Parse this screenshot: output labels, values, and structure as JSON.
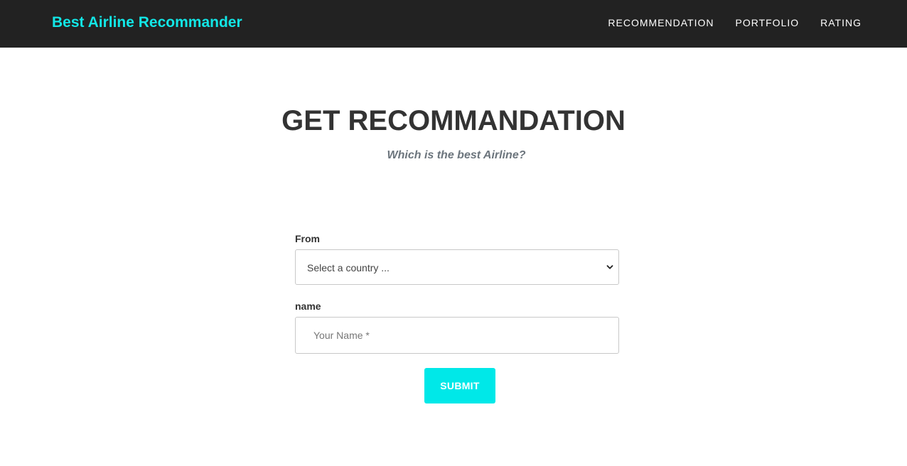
{
  "navbar": {
    "brand": "Best Airline Recommander",
    "links": [
      "RECOMMENDATION",
      "PORTFOLIO",
      "RATING"
    ]
  },
  "section": {
    "heading": "GET RECOMMANDATION",
    "subheading": "Which is the best Airline?"
  },
  "form": {
    "from_label": "From",
    "from_selected": "Select a country ...",
    "name_label": "name",
    "name_value": "",
    "name_placeholder": "Your Name *",
    "submit_label": "SUBMIT"
  },
  "icons": {
    "dropdown": "chevron-down-icon"
  },
  "colors": {
    "navbar_bg": "#222222",
    "brand": "#12e6e6",
    "accent": "#00e8e8",
    "heading": "#333333",
    "subheading": "#6c757d"
  }
}
